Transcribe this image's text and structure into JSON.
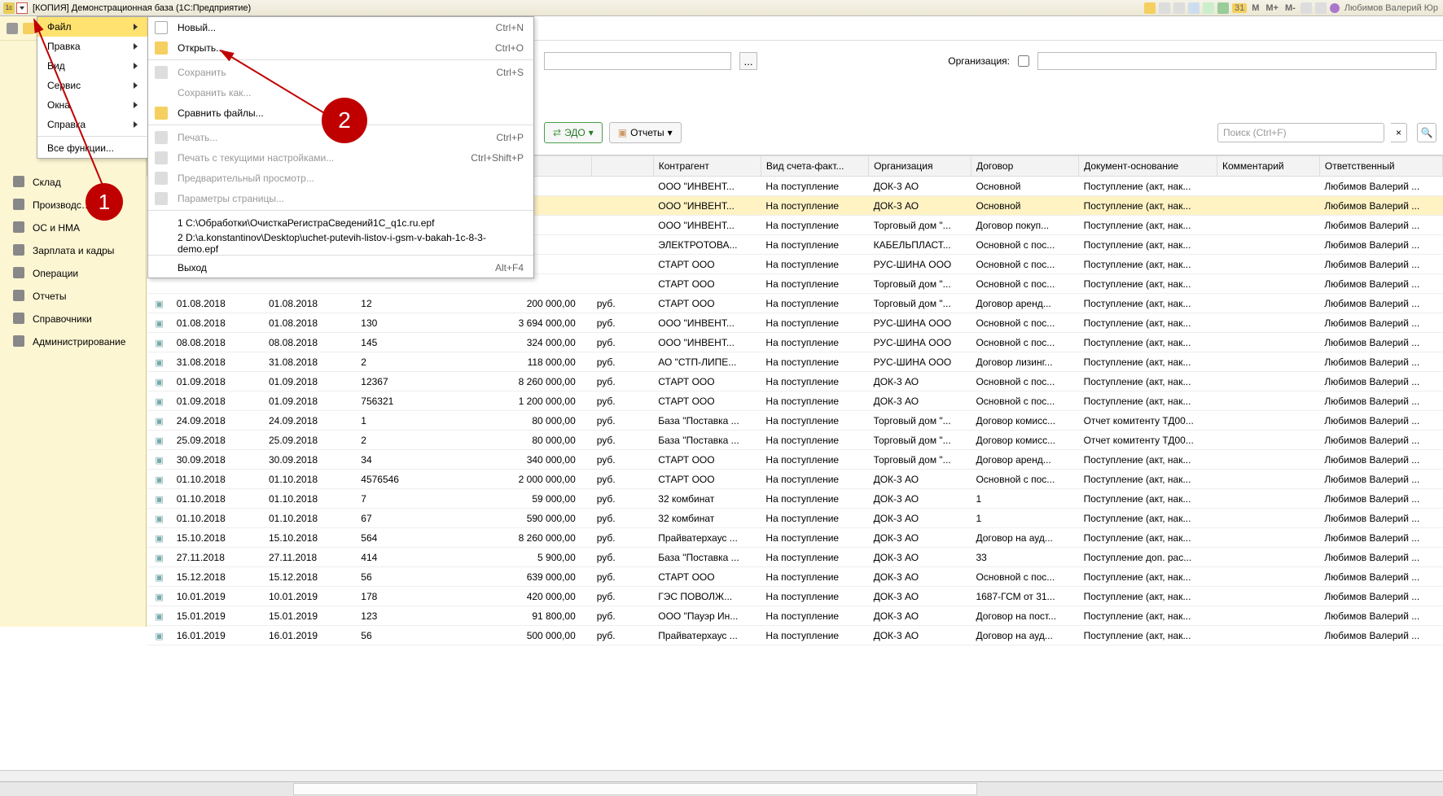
{
  "titlebar": {
    "title": "[КОПИЯ] Демонстрационная база  (1С:Предприятие)",
    "user": "Любимов Валерий Юр",
    "mbuttons": [
      "M",
      "M+",
      "M-"
    ],
    "date_badge": "31"
  },
  "mainmenu": {
    "items": [
      {
        "label": "Файл",
        "has_sub": true,
        "active": true,
        "underline": 0
      },
      {
        "label": "Правка",
        "has_sub": true,
        "underline": 0
      },
      {
        "label": "Вид",
        "has_sub": true,
        "underline": 0
      },
      {
        "label": "Сервис",
        "has_sub": true,
        "underline": 0
      },
      {
        "label": "Окна",
        "has_sub": true,
        "underline": 0
      },
      {
        "label": "Справка",
        "has_sub": true,
        "underline": 3
      }
    ],
    "all_functions": "Все функции..."
  },
  "submenu": {
    "new": "Новый...",
    "open": "Открыть...",
    "save": "Сохранить",
    "saveas": "Сохранить как...",
    "compare": "Сравнить файлы...",
    "print": "Печать...",
    "printwith": "Печать с текущими настройками...",
    "preview": "Предварительный просмотр...",
    "pagesetup": "Параметры страницы...",
    "recent1": "1 C:\\Обработки\\ОчисткаРегистраСведений1C_q1c.ru.epf",
    "recent2": "2 D:\\a.konstantinov\\Desktop\\uchet-putevih-listov-i-gsm-v-bakah-1c-8-3-demo.epf",
    "exit": "Выход",
    "sc_new": "Ctrl+N",
    "sc_open": "Ctrl+O",
    "sc_save": "Ctrl+S",
    "sc_print": "Ctrl+P",
    "sc_printwith": "Ctrl+Shift+P",
    "sc_exit": "Alt+F4"
  },
  "sidebar": {
    "items": [
      "Склад",
      "Производс…",
      "ОС и НМА",
      "Зарплата и кадры",
      "Операции",
      "Отчеты",
      "Справочники",
      "Администрирование"
    ]
  },
  "toolbar": {
    "org_label": "Организация:",
    "edo": "ЭДО",
    "reports": "Отчеты",
    "search_placeholder": "Поиск (Ctrl+F)"
  },
  "annotations": {
    "n1": "1",
    "n2": "2"
  },
  "table": {
    "headers": [
      "",
      "",
      "",
      "",
      "",
      "",
      "Контрагент",
      "Вид счета-факт...",
      "Организация",
      "Договор",
      "Документ-основание",
      "Комментарий",
      "Ответственный"
    ],
    "rows": [
      {
        "sel": false,
        "kontr": "ООО \"ИНВЕНТ...",
        "vid": "На поступление",
        "org": "ДОК-3 АО",
        "dog": "Основной",
        "doc": "Поступление (акт, нак...",
        "otv": "Любимов Валерий ..."
      },
      {
        "sel": true,
        "kontr": "ООО \"ИНВЕНТ...",
        "vid": "На поступление",
        "org": "ДОК-3 АО",
        "dog": "Основной",
        "doc": "Поступление (акт, нак...",
        "otv": "Любимов Валерий ..."
      },
      {
        "sel": false,
        "kontr": "ООО \"ИНВЕНТ...",
        "vid": "На поступление",
        "org": "Торговый дом \"...",
        "dog": "Договор покуп...",
        "doc": "Поступление (акт, нак...",
        "otv": "Любимов Валерий ..."
      },
      {
        "sel": false,
        "kontr": "ЭЛЕКТРОТОВА...",
        "vid": "На поступление",
        "org": "КАБЕЛЬПЛАСТ...",
        "dog": "Основной с пос...",
        "doc": "Поступление (акт, нак...",
        "otv": "Любимов Валерий ..."
      },
      {
        "sel": false,
        "kontr": "СТАРТ ООО",
        "vid": "На поступление",
        "org": "РУС-ШИНА ООО",
        "dog": "Основной с пос...",
        "doc": "Поступление (акт, нак...",
        "otv": "Любимов Валерий ..."
      },
      {
        "sel": false,
        "kontr": "СТАРТ ООО",
        "vid": "На поступление",
        "org": "Торговый дом \"...",
        "dog": "Основной с пос...",
        "doc": "Поступление (акт, нак...",
        "otv": "Любимов Валерий ..."
      },
      {
        "d1": "01.08.2018",
        "d2": "01.08.2018",
        "num": "12",
        "sum": "200 000,00",
        "cur": "руб.",
        "kontr": "СТАРТ ООО",
        "vid": "На поступление",
        "org": "Торговый дом \"...",
        "dog": "Договор аренд...",
        "doc": "Поступление (акт, нак...",
        "otv": "Любимов Валерий ..."
      },
      {
        "d1": "01.08.2018",
        "d2": "01.08.2018",
        "num": "130",
        "sum": "3 694 000,00",
        "cur": "руб.",
        "kontr": "ООО \"ИНВЕНТ...",
        "vid": "На поступление",
        "org": "РУС-ШИНА ООО",
        "dog": "Основной с пос...",
        "doc": "Поступление (акт, нак...",
        "otv": "Любимов Валерий ..."
      },
      {
        "d1": "08.08.2018",
        "d2": "08.08.2018",
        "num": "145",
        "sum": "324 000,00",
        "cur": "руб.",
        "kontr": "ООО \"ИНВЕНТ...",
        "vid": "На поступление",
        "org": "РУС-ШИНА ООО",
        "dog": "Основной с пос...",
        "doc": "Поступление (акт, нак...",
        "otv": "Любимов Валерий ..."
      },
      {
        "d1": "31.08.2018",
        "d2": "31.08.2018",
        "num": "2",
        "sum": "118 000,00",
        "cur": "руб.",
        "kontr": "АО \"СТП-ЛИПЕ...",
        "vid": "На поступление",
        "org": "РУС-ШИНА ООО",
        "dog": "Договор лизинг...",
        "doc": "Поступление (акт, нак...",
        "otv": "Любимов Валерий ..."
      },
      {
        "d1": "01.09.2018",
        "d2": "01.09.2018",
        "num": "12367",
        "sum": "8 260 000,00",
        "cur": "руб.",
        "kontr": "СТАРТ ООО",
        "vid": "На поступление",
        "org": "ДОК-3 АО",
        "dog": "Основной с пос...",
        "doc": "Поступление (акт, нак...",
        "otv": "Любимов Валерий ..."
      },
      {
        "d1": "01.09.2018",
        "d2": "01.09.2018",
        "num": "756321",
        "sum": "1 200 000,00",
        "cur": "руб.",
        "kontr": "СТАРТ ООО",
        "vid": "На поступление",
        "org": "ДОК-3 АО",
        "dog": "Основной с пос...",
        "doc": "Поступление (акт, нак...",
        "otv": "Любимов Валерий ..."
      },
      {
        "d1": "24.09.2018",
        "d2": "24.09.2018",
        "num": "1",
        "sum": "80 000,00",
        "cur": "руб.",
        "kontr": "База \"Поставка ...",
        "vid": "На поступление",
        "org": "Торговый дом \"...",
        "dog": "Договор комисс...",
        "doc": "Отчет комитенту ТД00...",
        "otv": "Любимов Валерий ..."
      },
      {
        "d1": "25.09.2018",
        "d2": "25.09.2018",
        "num": "2",
        "sum": "80 000,00",
        "cur": "руб.",
        "kontr": "База \"Поставка ...",
        "vid": "На поступление",
        "org": "Торговый дом \"...",
        "dog": "Договор комисс...",
        "doc": "Отчет комитенту ТД00...",
        "otv": "Любимов Валерий ..."
      },
      {
        "d1": "30.09.2018",
        "d2": "30.09.2018",
        "num": "34",
        "sum": "340 000,00",
        "cur": "руб.",
        "kontr": "СТАРТ ООО",
        "vid": "На поступление",
        "org": "Торговый дом \"...",
        "dog": "Договор аренд...",
        "doc": "Поступление (акт, нак...",
        "otv": "Любимов Валерий ..."
      },
      {
        "d1": "01.10.2018",
        "d2": "01.10.2018",
        "num": "4576546",
        "sum": "2 000 000,00",
        "cur": "руб.",
        "kontr": "СТАРТ ООО",
        "vid": "На поступление",
        "org": "ДОК-3 АО",
        "dog": "Основной с пос...",
        "doc": "Поступление (акт, нак...",
        "otv": "Любимов Валерий ..."
      },
      {
        "d1": "01.10.2018",
        "d2": "01.10.2018",
        "num": "7",
        "sum": "59 000,00",
        "cur": "руб.",
        "kontr": "32 комбинат",
        "vid": "На поступление",
        "org": "ДОК-3 АО",
        "dog": "1",
        "doc": "Поступление (акт, нак...",
        "otv": "Любимов Валерий ..."
      },
      {
        "d1": "01.10.2018",
        "d2": "01.10.2018",
        "num": "67",
        "sum": "590 000,00",
        "cur": "руб.",
        "kontr": "32 комбинат",
        "vid": "На поступление",
        "org": "ДОК-3 АО",
        "dog": "1",
        "doc": "Поступление (акт, нак...",
        "otv": "Любимов Валерий ..."
      },
      {
        "d1": "15.10.2018",
        "d2": "15.10.2018",
        "num": "564",
        "sum": "8 260 000,00",
        "cur": "руб.",
        "kontr": "Прайватерхаус ...",
        "vid": "На поступление",
        "org": "ДОК-3 АО",
        "dog": "Договор на ауд...",
        "doc": "Поступление (акт, нак...",
        "otv": "Любимов Валерий ..."
      },
      {
        "d1": "27.11.2018",
        "d2": "27.11.2018",
        "num": "414",
        "sum": "5 900,00",
        "cur": "руб.",
        "kontr": "База \"Поставка ...",
        "vid": "На поступление",
        "org": "ДОК-3 АО",
        "dog": "33",
        "doc": "Поступление доп. рас...",
        "otv": "Любимов Валерий ..."
      },
      {
        "d1": "15.12.2018",
        "d2": "15.12.2018",
        "num": "56",
        "sum": "639 000,00",
        "cur": "руб.",
        "kontr": "СТАРТ ООО",
        "vid": "На поступление",
        "org": "ДОК-3 АО",
        "dog": "Основной с пос...",
        "doc": "Поступление (акт, нак...",
        "otv": "Любимов Валерий ..."
      },
      {
        "d1": "10.01.2019",
        "d2": "10.01.2019",
        "num": "178",
        "sum": "420 000,00",
        "cur": "руб.",
        "kontr": "ГЭС ПОВОЛЖ...",
        "vid": "На поступление",
        "org": "ДОК-3 АО",
        "dog": "1687-ГСМ от 31...",
        "doc": "Поступление (акт, нак...",
        "otv": "Любимов Валерий ..."
      },
      {
        "d1": "15.01.2019",
        "d2": "15.01.2019",
        "num": "123",
        "sum": "91 800,00",
        "cur": "руб.",
        "kontr": "ООО \"Пауэр Ин...",
        "vid": "На поступление",
        "org": "ДОК-3 АО",
        "dog": "Договор на пост...",
        "doc": "Поступление (акт, нак...",
        "otv": "Любимов Валерий ..."
      },
      {
        "d1": "16.01.2019",
        "d2": "16.01.2019",
        "num": "56",
        "sum": "500 000,00",
        "cur": "руб.",
        "kontr": "Прайватерхаус ...",
        "vid": "На поступление",
        "org": "ДОК-3 АО",
        "dog": "Договор на ауд...",
        "doc": "Поступление (акт, нак...",
        "otv": "Любимов Валерий ..."
      }
    ]
  }
}
